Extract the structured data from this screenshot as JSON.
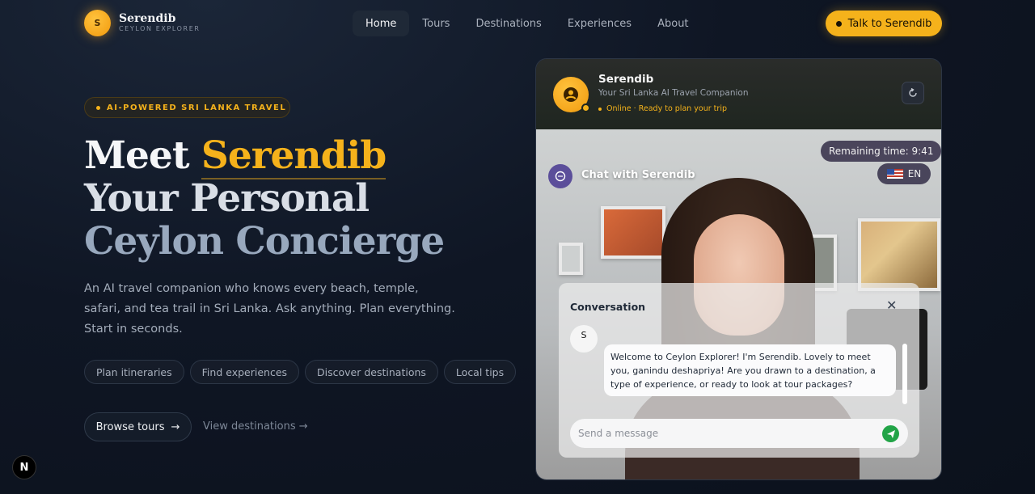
{
  "nav": {
    "logo_letter": "S",
    "brand_name": "Serendib",
    "brand_sub": "CEYLON EXPLORER",
    "links": [
      "Home",
      "Tours",
      "Destinations",
      "Experiences",
      "About"
    ],
    "active_link": "Home",
    "cta_label": "Talk to Serendib"
  },
  "hero": {
    "badge": "AI-POWERED SRI LANKA TRAVEL",
    "title_prefix": "Meet",
    "title_accent": "Serendib",
    "title_line2": "Your Personal",
    "title_line3": "Ceylon Concierge",
    "description": "An AI travel companion who knows every beach, temple, safari, and tea trail in Sri Lanka. Ask anything. Plan everything. Start in seconds.",
    "chips": [
      "Plan itineraries",
      "Find experiences",
      "Discover destinations",
      "Local tips"
    ],
    "browse_label": "Browse tours",
    "browse_arrow": "→",
    "view_destinations": "View destinations →"
  },
  "chat": {
    "agent_name": "Serendib",
    "agent_subtitle": "Your Sri Lanka AI Travel Companion",
    "status": "Online · Ready to plan your trip",
    "remaining_time": "Remaining time: 9:41",
    "language": "EN",
    "chat_title": "Chat with Serendib",
    "conversation_title": "Conversation",
    "close_symbol": "✕",
    "bot_initial": "S",
    "message": "Welcome to Ceylon Explorer! I'm Serendib. Lovely to meet you, ganindu deshapriya! Are you drawn to a destination, a type of experience, or ready to look at tour packages?",
    "input_placeholder": "Send a message"
  },
  "dev_badge": "N",
  "colors": {
    "accent": "#f5b21b",
    "background": "#0f1624",
    "send_button": "#22a447"
  }
}
